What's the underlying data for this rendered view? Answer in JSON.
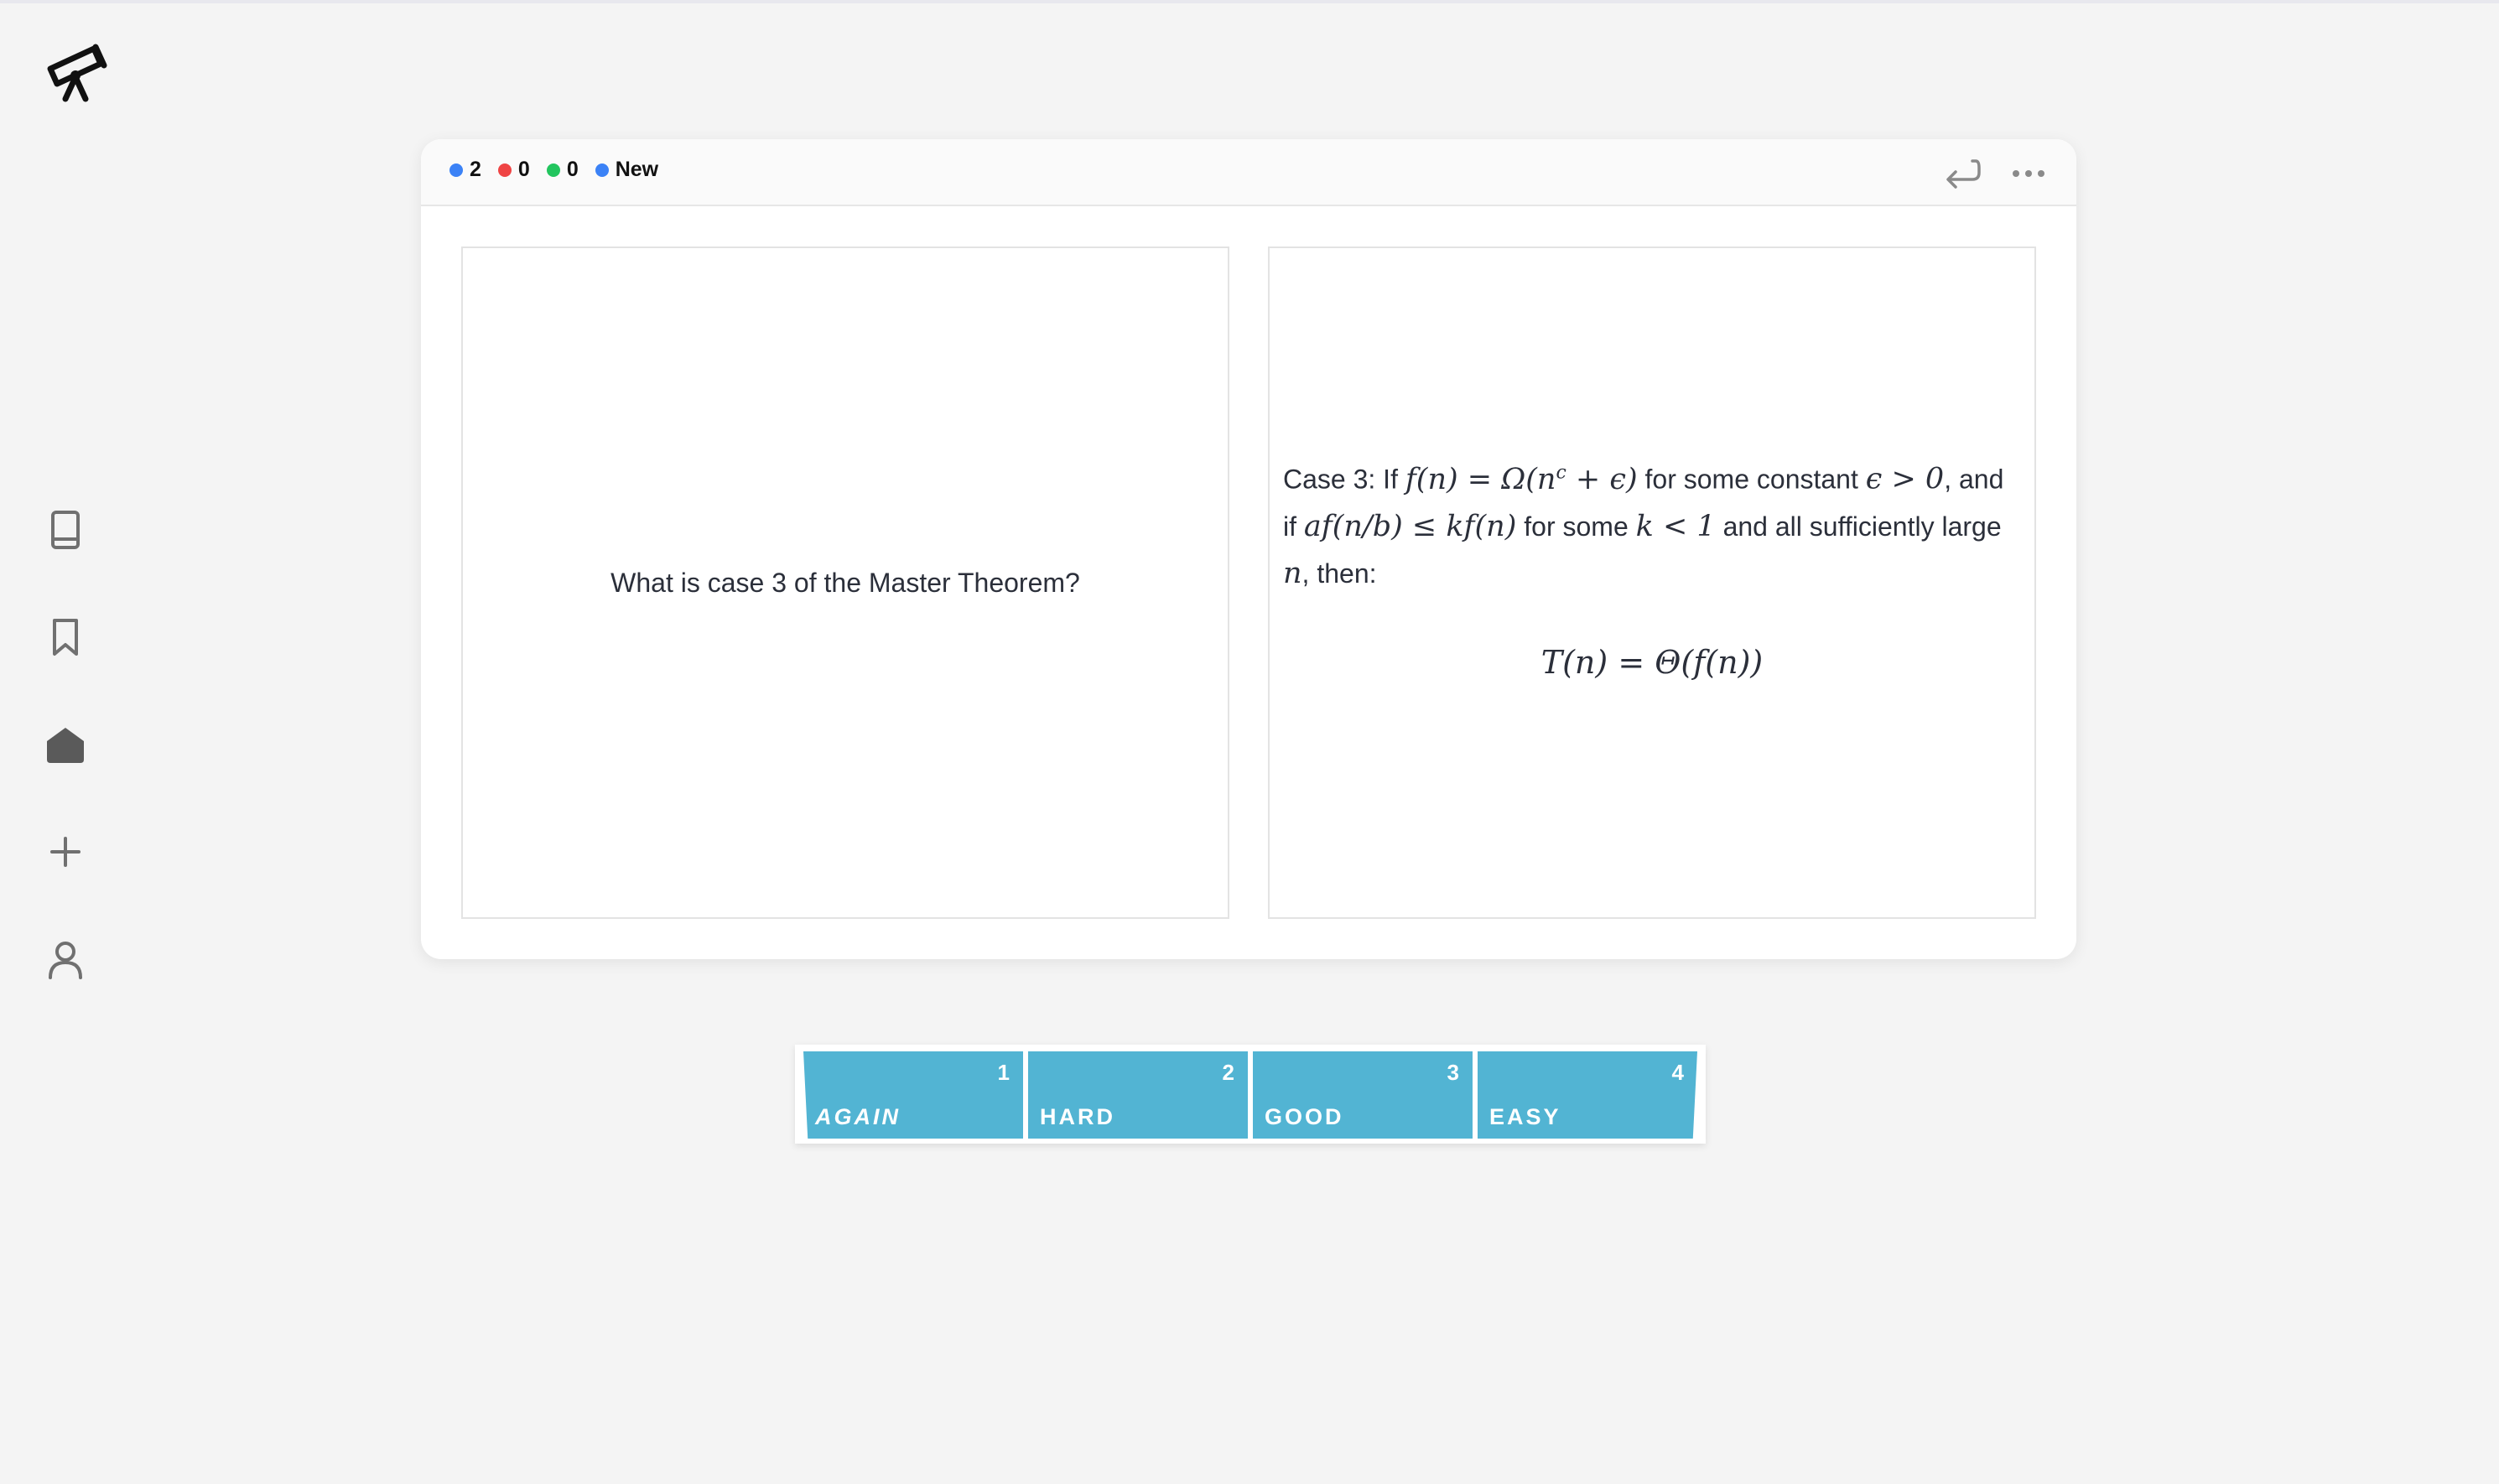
{
  "sidebar": {
    "icons": [
      "telescope-icon",
      "book-icon",
      "bookmark-icon",
      "home-icon",
      "plus-icon",
      "user-icon"
    ]
  },
  "header": {
    "counts": [
      {
        "value": "2",
        "color": "#3b82f6"
      },
      {
        "value": "0",
        "color": "#ef4444"
      },
      {
        "value": "0",
        "color": "#22c55e"
      }
    ],
    "new_label": "New",
    "new_color": "#3b82f6"
  },
  "card": {
    "question": "What is case 3 of the Master Theorem?",
    "answer": {
      "t1": "Case 3: If ",
      "m1": "f(n) = Ω(n",
      "m1sup": "c",
      "m1b": " + ϵ)",
      "t2": " for some constant ",
      "m2": "ϵ > 0",
      "t3": ", and if ",
      "m3": "af(n/b) ≤ kf(n)",
      "t4": " for some ",
      "m4": "k < 1",
      "t5": " and all sufficiently large ",
      "m5": "n",
      "t6": ", then:",
      "display": "T(n) = Θ(f(n))"
    }
  },
  "grades": [
    {
      "key": "1",
      "label": "AGAIN"
    },
    {
      "key": "2",
      "label": "HARD"
    },
    {
      "key": "3",
      "label": "GOOD"
    },
    {
      "key": "4",
      "label": "EASY"
    }
  ],
  "colors": {
    "grade_button": "#52b4d3",
    "background": "#f4f4f4"
  }
}
